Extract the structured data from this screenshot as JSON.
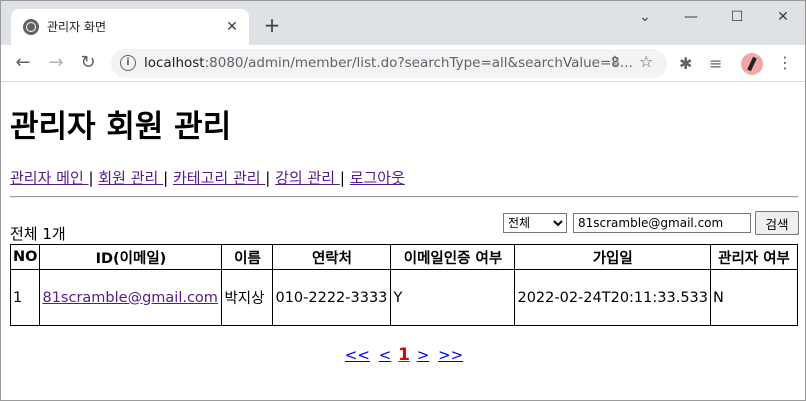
{
  "browser": {
    "tab_title": "관리자 화면",
    "url_host": "localhost",
    "url_rest": ":8080/admin/member/list.do?searchType=all&searchValue=8..."
  },
  "page": {
    "heading": "관리자 회원 관리",
    "nav": [
      {
        "label": "관리자 메인 "
      },
      {
        "label": "회원 관리 "
      },
      {
        "label": "카테고리 관리 "
      },
      {
        "label": "강의 관리 "
      },
      {
        "label": "로그아웃"
      }
    ],
    "total_text": "전체 1개",
    "search": {
      "type_selected": "전체",
      "value": "81scramble@gmail.com",
      "button": "검색"
    },
    "table": {
      "headers": [
        "NO",
        "ID(이메일)",
        "이름",
        "연락처",
        "이메일인증 여부",
        "가입일",
        "관리자 여부"
      ],
      "rows": [
        {
          "no": "1",
          "email": "81scramble@gmail.com",
          "name": "박지상",
          "phone": "010-2222-3333",
          "email_auth": "Y",
          "joined": "2022-02-24T20:11:33.533",
          "admin": "N"
        }
      ]
    },
    "pager": {
      "first": "<<",
      "prev": "<",
      "current": "1",
      "next": ">",
      "last": ">>"
    }
  }
}
